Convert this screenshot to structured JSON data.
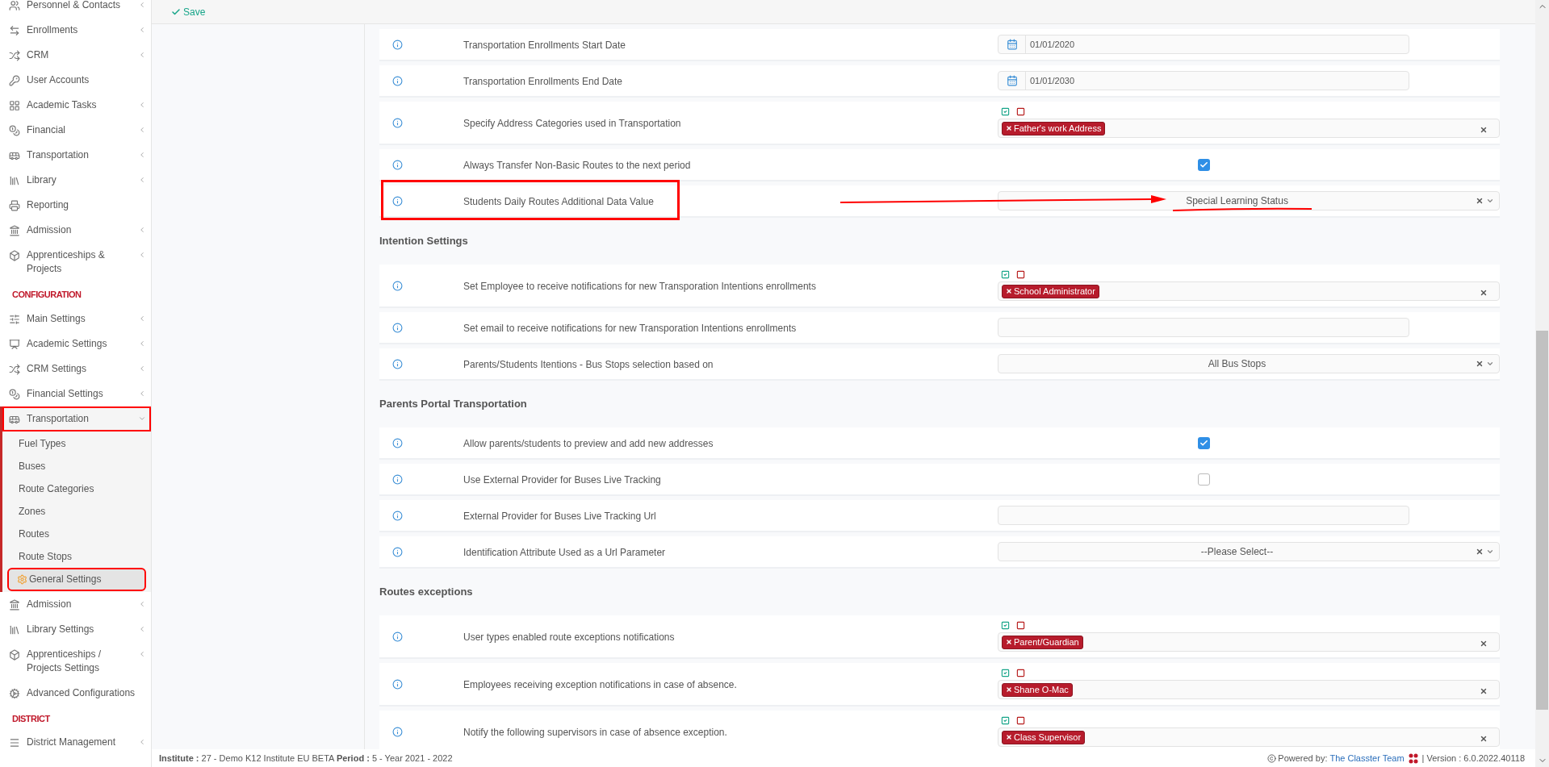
{
  "toolbar": {
    "save": "Save"
  },
  "sidebar": {
    "groups": [
      {
        "items": [
          {
            "label": "Personnel & Contacts",
            "expandable": true,
            "expanded": false,
            "highlighted": false
          },
          {
            "label": "Enrollments",
            "expandable": true,
            "expanded": false,
            "highlighted": false
          },
          {
            "label": "CRM",
            "expandable": true,
            "expanded": false,
            "highlighted": false
          },
          {
            "label": "User Accounts",
            "expandable": false,
            "expanded": false,
            "highlighted": false
          },
          {
            "label": "Academic Tasks",
            "expandable": true,
            "expanded": false,
            "highlighted": false
          },
          {
            "label": "Financial",
            "expandable": true,
            "expanded": false,
            "highlighted": false
          },
          {
            "label": "Transportation",
            "expandable": true,
            "expanded": false,
            "highlighted": false
          },
          {
            "label": "Library",
            "expandable": true,
            "expanded": false,
            "highlighted": false
          },
          {
            "label": "Reporting",
            "expandable": false,
            "expanded": false,
            "highlighted": false
          },
          {
            "label": "Admission",
            "expandable": true,
            "expanded": false,
            "highlighted": false
          },
          {
            "label": "Apprenticeships & Projects",
            "expandable": true,
            "expanded": false,
            "highlighted": false
          }
        ]
      },
      {
        "title": "CONFIGURATION",
        "items": [
          {
            "label": "Main Settings",
            "expandable": true,
            "expanded": false,
            "highlighted": false
          },
          {
            "label": "Academic Settings",
            "expandable": true,
            "expanded": false,
            "highlighted": false
          },
          {
            "label": "CRM Settings",
            "expandable": true,
            "expanded": false,
            "highlighted": false
          },
          {
            "label": "Financial Settings",
            "expandable": true,
            "expanded": false,
            "highlighted": false
          },
          {
            "label": "Transportation",
            "expandable": true,
            "expanded": true,
            "highlighted": true,
            "children": [
              {
                "label": "Fuel Types",
                "selected": false,
                "highlighted": false
              },
              {
                "label": "Buses",
                "selected": false,
                "highlighted": false
              },
              {
                "label": "Route Categories",
                "selected": false,
                "highlighted": false
              },
              {
                "label": "Zones",
                "selected": false,
                "highlighted": false
              },
              {
                "label": "Routes",
                "selected": false,
                "highlighted": false
              },
              {
                "label": "Route Stops",
                "selected": false,
                "highlighted": false
              },
              {
                "label": "General Settings",
                "selected": true,
                "highlighted": true
              }
            ]
          },
          {
            "label": "Admission",
            "expandable": true,
            "expanded": false,
            "highlighted": false
          },
          {
            "label": "Library Settings",
            "expandable": true,
            "expanded": false,
            "highlighted": false
          },
          {
            "label": "Apprenticeships / Projects Settings",
            "expandable": true,
            "expanded": false,
            "highlighted": false
          },
          {
            "label": "Advanced Configurations",
            "expandable": false,
            "expanded": false,
            "highlighted": false
          }
        ]
      },
      {
        "title": "DISTRICT",
        "items": [
          {
            "label": "District Management",
            "expandable": true,
            "expanded": false,
            "highlighted": false
          }
        ]
      }
    ]
  },
  "sections": [
    {
      "rows": [
        {
          "label": "Transportation Enrollments Start Date",
          "kind": "date",
          "value": "01/01/2020",
          "highlighted": false
        },
        {
          "label": "Transportation Enrollments End Date",
          "kind": "date",
          "value": "01/01/2030",
          "highlighted": false
        },
        {
          "label": "Specify Address Categories used in Transportation",
          "kind": "multiselect",
          "tags": [
            "Father's work Address"
          ],
          "highlighted": false
        },
        {
          "label": "Always Transfer Non-Basic Routes to the next period",
          "kind": "checkbox",
          "checked": true,
          "highlighted": false
        },
        {
          "label": "Students Daily Routes Additional Data Value",
          "kind": "select",
          "value": "Special Learning Status",
          "highlighted": true
        }
      ]
    },
    {
      "heading": "Intention Settings",
      "rows": [
        {
          "label": "Set Employee to receive notifications for new Transporation Intentions enrollments",
          "kind": "multiselect",
          "tags": [
            "School Administrator"
          ],
          "highlighted": false
        },
        {
          "label": "Set email to receive notifications for new Transporation Intentions enrollments",
          "kind": "text",
          "highlighted": false
        },
        {
          "label": "Parents/Students Itentions - Bus Stops selection based on",
          "kind": "select",
          "value": "All Bus Stops",
          "highlighted": false
        }
      ]
    },
    {
      "heading": "Parents Portal Transportation",
      "rows": [
        {
          "label": "Allow parents/students to preview and add new addresses",
          "kind": "checkbox",
          "checked": true,
          "highlighted": false
        },
        {
          "label": "Use External Provider for Buses Live Tracking",
          "kind": "checkbox",
          "checked": false,
          "highlighted": false
        },
        {
          "label": "External Provider for Buses Live Tracking Url",
          "kind": "text",
          "highlighted": false
        },
        {
          "label": "Identification Attribute Used as a Url Parameter",
          "kind": "select",
          "value": "--Please Select--",
          "highlighted": false
        }
      ]
    },
    {
      "heading": "Routes exceptions",
      "rows": [
        {
          "label": "User types enabled route exceptions notifications",
          "kind": "multiselect",
          "tags": [
            "Parent/Guardian"
          ],
          "highlighted": false
        },
        {
          "label": "Employees receiving exception notifications in case of absence.",
          "kind": "multiselect",
          "tags": [
            "Shane O-Mac"
          ],
          "highlighted": false
        },
        {
          "label": "Notify the following supervisors in case of absence exception.",
          "kind": "multiselect",
          "tags": [
            "Class Supervisor"
          ],
          "highlighted": false
        }
      ]
    }
  ],
  "footer": {
    "institute": "**Institute :** 27 - Demo K12 Institute EU BETA **Period :** 5 - Year 2021 - 2022",
    "powered_by": "Powered by:",
    "team_link": "The Classter Team",
    "version": "| Version : 6.0.2022.40118"
  }
}
